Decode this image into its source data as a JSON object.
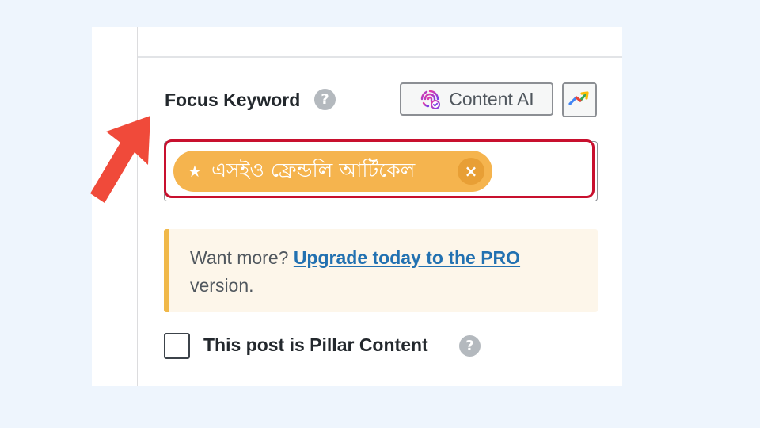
{
  "focus_keyword": {
    "label": "Focus Keyword",
    "help_icon": "help-circle-icon",
    "content_ai_button": {
      "label": "Content AI",
      "icon": "content-ai-fingerprint-icon"
    },
    "trends_button": {
      "icon": "trending-up-icon"
    },
    "keyword_tag": {
      "text": "এসইও ফ্রেন্ডলি আর্টিকেল",
      "star_icon": "★",
      "remove_icon": "×"
    },
    "highlight_color": "#c8102e"
  },
  "notice": {
    "prefix": "Want more?",
    "link_text": "Upgrade today to the PRO",
    "suffix": "version.",
    "accent_color": "#f0b849"
  },
  "pillar_content": {
    "label": "This post is Pillar Content",
    "checked": false,
    "help_icon": "help-circle-icon"
  },
  "annotation": {
    "arrow_color": "#f04a3a",
    "icon": "red-pointer-arrow-icon"
  },
  "help_glyph": "?"
}
